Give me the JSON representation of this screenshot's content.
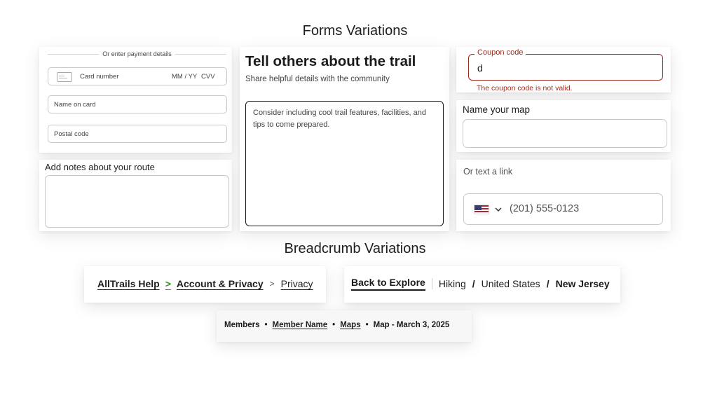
{
  "forms_title": "Forms Variations",
  "breadcrumb_title": "Breadcrumb Variations",
  "payment": {
    "divider_text": "Or enter payment details",
    "card_number_placeholder": "Card number",
    "expiry_placeholder": "MM / YY",
    "cvv_placeholder": "CVV",
    "name_placeholder": "Name on card",
    "postal_placeholder": "Postal code"
  },
  "route_notes": {
    "label": "Add notes about your route",
    "value": ""
  },
  "trail_review": {
    "heading": "Tell others about the trail",
    "subheading": "Share helpful details with the community",
    "placeholder": "Consider including cool trail features, facilities, and tips to come prepared."
  },
  "coupon": {
    "label": "Coupon code",
    "value": "d",
    "error": "The coupon code is not valid.",
    "error_color": "#9b2c1f"
  },
  "map_name": {
    "label": "Name your map",
    "value": ""
  },
  "text_link": {
    "label": "Or text a link",
    "country_icon": "us-flag-icon",
    "phone_placeholder": "(201) 555-0123"
  },
  "breadcrumb_1": {
    "items": [
      "AllTrails Help",
      "Account & Privacy",
      "Privacy"
    ],
    "sep1": ">",
    "sep2": ">",
    "accent_color": "#3f8c2a"
  },
  "breadcrumb_2": {
    "back": "Back to Explore",
    "items": [
      "Hiking",
      "United States",
      "New Jersey"
    ],
    "sep": "/"
  },
  "breadcrumb_3": {
    "items": [
      "Members",
      "Member Name",
      "Maps",
      "Map - March 3, 2025"
    ],
    "sep": "•"
  }
}
